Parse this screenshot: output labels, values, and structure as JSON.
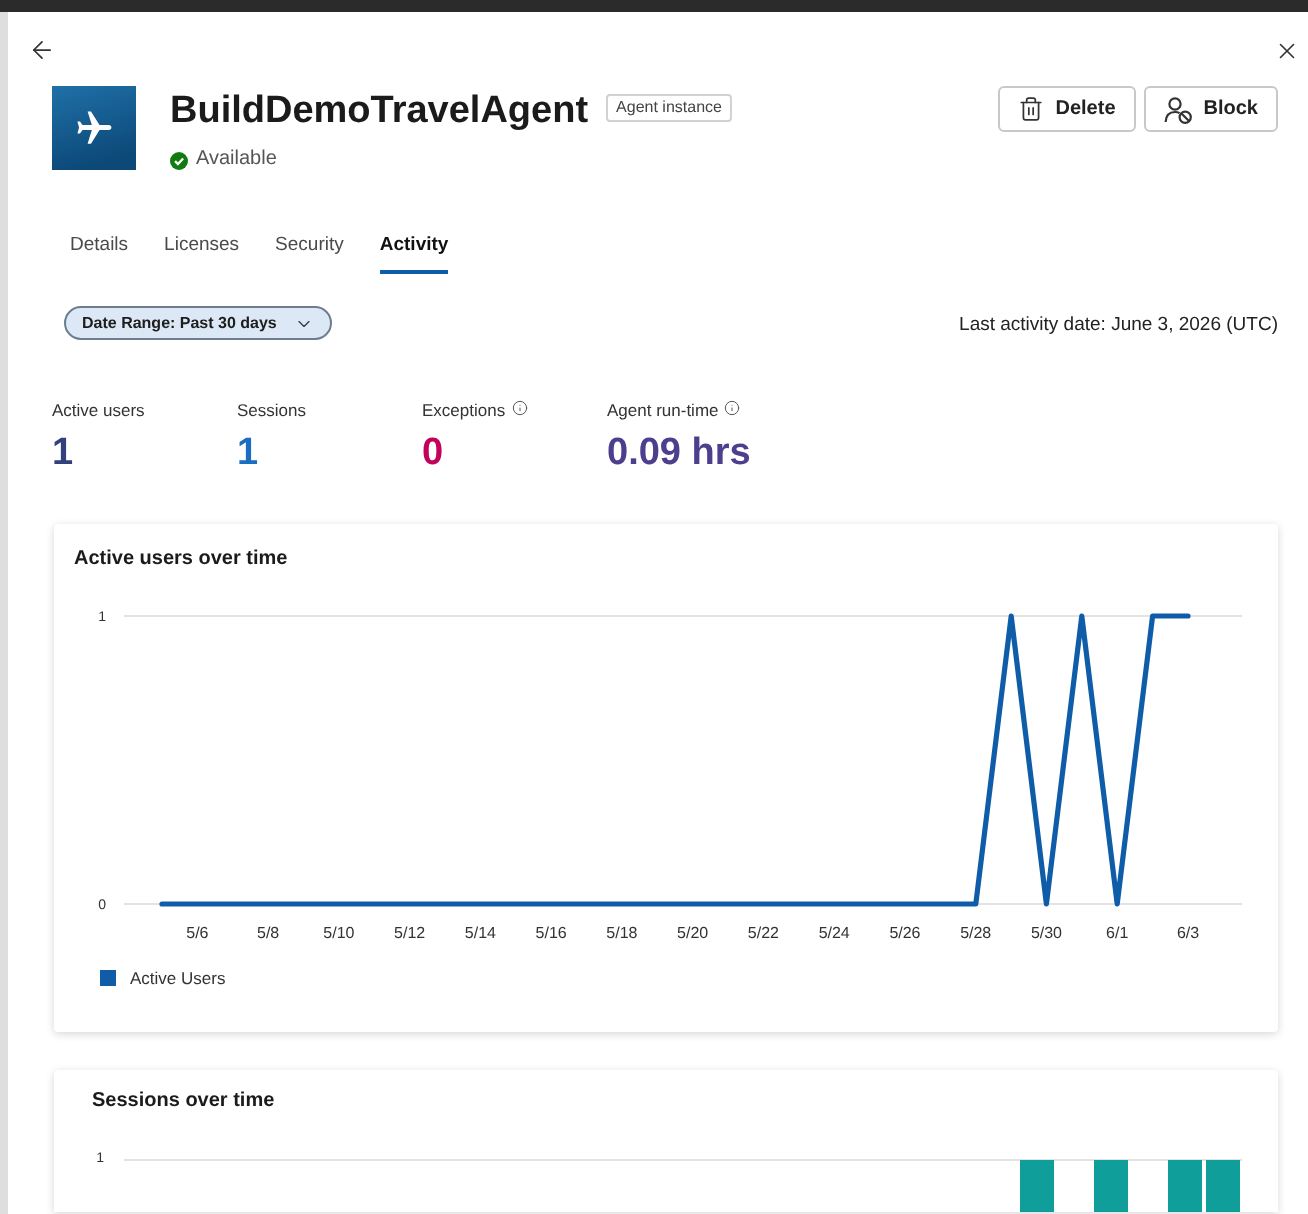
{
  "agent": {
    "name": "BuildDemoTravelAgent",
    "badge": "Agent instance",
    "status": "Available"
  },
  "actions": [
    {
      "kind": "delete",
      "label": "Delete"
    },
    {
      "kind": "block",
      "label": "Block"
    }
  ],
  "tabs": [
    {
      "label": "Details",
      "selected": false
    },
    {
      "label": "Licenses",
      "selected": false
    },
    {
      "label": "Security",
      "selected": false
    },
    {
      "label": "Activity",
      "selected": true
    }
  ],
  "date_range": {
    "label": "Date Range: Past 30 days"
  },
  "last_activity": "Last activity date: June 3, 2026 (UTC)",
  "stats": [
    {
      "label": "Active users",
      "value": "1",
      "color": "#33407e",
      "info": false
    },
    {
      "label": "Sessions",
      "value": "1",
      "color": "#1a6dc0",
      "info": false
    },
    {
      "label": "Exceptions",
      "value": "0",
      "color": "#c3005b",
      "info": true
    },
    {
      "label": "Agent run-time",
      "value": "0.09 hrs",
      "color": "#4e3f8e",
      "info": true
    }
  ],
  "active_users_card": {
    "title": "Active users over time",
    "chart_data": {
      "type": "line",
      "categories": [
        null,
        "5/6",
        null,
        "5/8",
        null,
        "5/10",
        null,
        "5/12",
        null,
        "5/14",
        null,
        "5/16",
        null,
        "5/18",
        null,
        "5/20",
        null,
        "5/22",
        null,
        "5/24",
        null,
        "5/26",
        null,
        "5/28",
        null,
        "5/30",
        null,
        "6/1",
        null,
        "6/3"
      ],
      "ylim": [
        0,
        1
      ],
      "yticks": [
        0,
        1
      ],
      "series": [
        {
          "name": "Active Users",
          "color": "#0f5ca8",
          "values": [
            0,
            0,
            0,
            0,
            0,
            0,
            0,
            0,
            0,
            0,
            0,
            0,
            0,
            0,
            0,
            0,
            0,
            0,
            0,
            0,
            0,
            0,
            0,
            0,
            1,
            0,
            1,
            0,
            1,
            1
          ]
        }
      ]
    }
  },
  "sessions_card": {
    "title": "Sessions over time",
    "y_axis_label": "1"
  }
}
